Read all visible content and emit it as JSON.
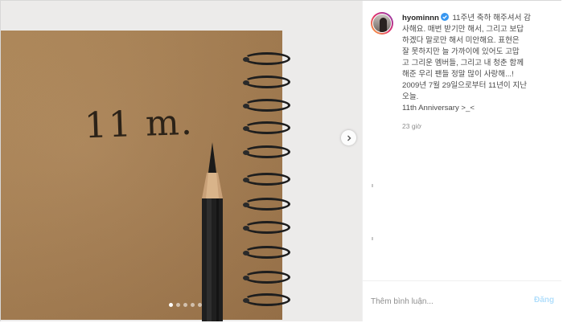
{
  "post": {
    "username": "hyominnn",
    "caption_lines": [
      "11주년 축하 해주셔서 감",
      "사해요. 매번 받기만 해서, 그리고 보답",
      "하겠다 말로만 해서 미안해요. 표현은",
      "잘 못하지만 늘 가까이에 있어도 고맙",
      "고 그리운 멤버들, 그리고 내 청춘 함께",
      "해준 우리 팬들 정말 많이 사랑해...!",
      "2009년 7월 29일으로부터 11년이 지난",
      "오늘."
    ],
    "anniversary_line": "11th Anniversary >_<",
    "timestamp": "23 giờ"
  },
  "photo": {
    "handwriting": "11 m.",
    "carousel_count": 5,
    "carousel_active": 1
  },
  "comment": {
    "placeholder": "Thêm bình luận...",
    "post_label": "Đăng"
  },
  "colors": {
    "accent_disabled": "#b2dffc",
    "verified": "#3897f0",
    "cardboard": "#a67e51"
  },
  "icons": {
    "verified": "verified-badge-icon",
    "next": "chevron-right-icon"
  }
}
